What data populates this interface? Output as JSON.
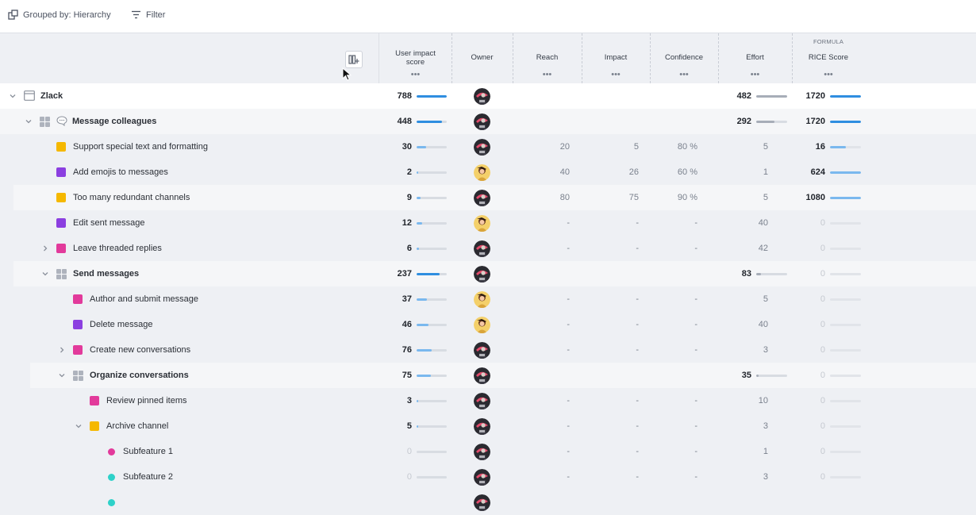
{
  "toolbar": {
    "grouped_by_label": "Grouped by: Hierarchy",
    "filter_label": "Filter"
  },
  "columns": {
    "user_impact": "User impact score",
    "owner": "Owner",
    "reach": "Reach",
    "impact": "Impact",
    "confidence": "Confidence",
    "effort": "Effort",
    "formula_label": "FORMULA",
    "rice": "RICE Score",
    "menu_dots": "•••"
  },
  "colors": {
    "accent_bar": "#2f8ee0",
    "light_bar": "#7ab8ee",
    "effort_bar": "#a7adb8",
    "yellow": "#f5b800",
    "purple": "#8b3fe0",
    "pink": "#e23a9b",
    "teal": "#2ed1c9"
  },
  "rows": [
    {
      "name": "Zlack",
      "uis": "788",
      "uis_fill": 1.0,
      "avatar": "dark",
      "reach": "",
      "impact": "",
      "confidence": "",
      "effort": "482",
      "effort_fill": 1.0,
      "rice": "1720",
      "rice_fill": 1.0
    },
    {
      "name": "Message colleagues",
      "uis": "448",
      "uis_fill": 0.85,
      "avatar": "dark",
      "reach": "",
      "impact": "",
      "confidence": "",
      "effort": "292",
      "effort_fill": 0.6,
      "rice": "1720",
      "rice_fill": 1.0
    },
    {
      "name": "Support special text and formatting",
      "uis": "30",
      "uis_fill": 0.32,
      "avatar": "dark",
      "reach": "20",
      "impact": "5",
      "confidence": "80 %",
      "effort": "5",
      "rice": "16",
      "rice_fill": 0.5
    },
    {
      "name": "Add emojis to messages",
      "uis": "2",
      "uis_fill": 0.05,
      "avatar": "light",
      "reach": "40",
      "impact": "26",
      "confidence": "60 %",
      "effort": "1",
      "rice": "624",
      "rice_fill": 1.0
    },
    {
      "name": "Too many redundant channels",
      "uis": "9",
      "uis_fill": 0.12,
      "avatar": "dark",
      "reach": "80",
      "impact": "75",
      "confidence": "90 %",
      "effort": "5",
      "rice": "1080",
      "rice_fill": 1.0
    },
    {
      "name": "Edit sent message",
      "uis": "12",
      "uis_fill": 0.18,
      "avatar": "light",
      "reach": "-",
      "impact": "-",
      "confidence": "-",
      "effort": "40",
      "rice": "0",
      "rice_fill": 0
    },
    {
      "name": "Leave threaded replies",
      "uis": "6",
      "uis_fill": 0.08,
      "avatar": "dark",
      "reach": "-",
      "impact": "-",
      "confidence": "-",
      "effort": "42",
      "rice": "0",
      "rice_fill": 0
    },
    {
      "name": "Send messages",
      "uis": "237",
      "uis_fill": 0.75,
      "avatar": "dark",
      "reach": "",
      "impact": "",
      "confidence": "",
      "effort": "83",
      "effort_fill": 0.15,
      "rice": "0",
      "rice_fill": 0
    },
    {
      "name": "Author and submit message",
      "uis": "37",
      "uis_fill": 0.35,
      "avatar": "light",
      "reach": "-",
      "impact": "-",
      "confidence": "-",
      "effort": "5",
      "rice": "0",
      "rice_fill": 0
    },
    {
      "name": "Delete message",
      "uis": "46",
      "uis_fill": 0.4,
      "avatar": "light",
      "reach": "-",
      "impact": "-",
      "confidence": "-",
      "effort": "40",
      "rice": "0",
      "rice_fill": 0
    },
    {
      "name": "Create new conversations",
      "uis": "76",
      "uis_fill": 0.5,
      "avatar": "dark",
      "reach": "-",
      "impact": "-",
      "confidence": "-",
      "effort": "3",
      "rice": "0",
      "rice_fill": 0
    },
    {
      "name": "Organize conversations",
      "uis": "75",
      "uis_fill": 0.48,
      "avatar": "dark",
      "reach": "",
      "impact": "",
      "confidence": "",
      "effort": "35",
      "effort_fill": 0.08,
      "rice": "0",
      "rice_fill": 0
    },
    {
      "name": "Review pinned items",
      "uis": "3",
      "uis_fill": 0.05,
      "avatar": "dark",
      "reach": "-",
      "impact": "-",
      "confidence": "-",
      "effort": "10",
      "rice": "0",
      "rice_fill": 0
    },
    {
      "name": "Archive channel",
      "uis": "5",
      "uis_fill": 0.06,
      "avatar": "dark",
      "reach": "-",
      "impact": "-",
      "confidence": "-",
      "effort": "3",
      "rice": "0",
      "rice_fill": 0
    },
    {
      "name": "Subfeature 1",
      "uis": "0",
      "uis_fill": 0,
      "avatar": "dark",
      "reach": "-",
      "impact": "-",
      "confidence": "-",
      "effort": "1",
      "rice": "0",
      "rice_fill": 0
    },
    {
      "name": "Subfeature 2",
      "uis": "0",
      "uis_fill": 0,
      "avatar": "dark",
      "reach": "-",
      "impact": "-",
      "confidence": "-",
      "effort": "3",
      "rice": "0",
      "rice_fill": 0
    },
    {
      "name": "",
      "uis": "",
      "uis_fill": 0,
      "avatar": "dark",
      "reach": "",
      "impact": "",
      "confidence": "",
      "effort": "",
      "rice": "",
      "rice_fill": 0
    }
  ]
}
